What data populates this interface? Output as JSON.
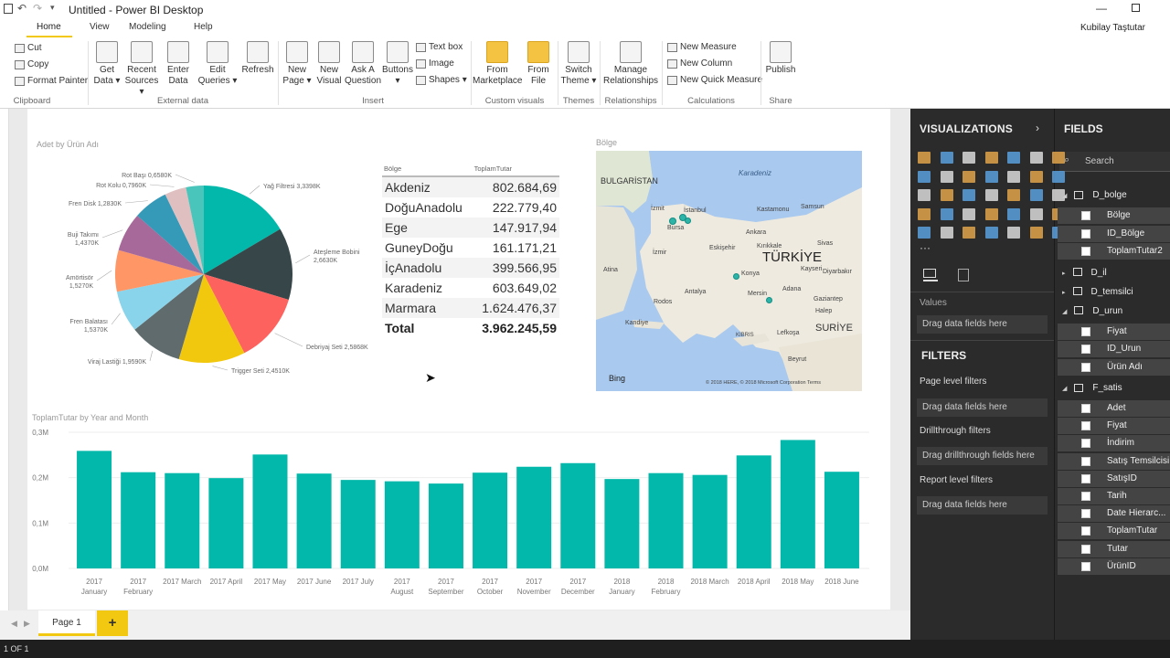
{
  "app": {
    "title": "Untitled - Power BI Desktop",
    "user": "Kubilay Taştutar"
  },
  "tabs": [
    "Home",
    "View",
    "Modeling",
    "Help"
  ],
  "ribbon": {
    "clipboard": {
      "cut": "Cut",
      "copy": "Copy",
      "format_painter": "Format Painter",
      "group": "Clipboard"
    },
    "buttons": [
      {
        "line1": "Get",
        "line2": "Data ▾"
      },
      {
        "line1": "Recent",
        "line2": "Sources ▾"
      },
      {
        "line1": "Enter",
        "line2": "Data"
      },
      {
        "line1": "Edit",
        "line2": "Queries ▾"
      },
      {
        "line1": "Refresh",
        "line2": ""
      },
      {
        "line1": "New",
        "line2": "Page ▾"
      },
      {
        "line1": "New",
        "line2": "Visual"
      },
      {
        "line1": "Ask A",
        "line2": "Question"
      },
      {
        "line1": "Buttons",
        "line2": "▾"
      },
      {
        "line1": "From",
        "line2": "Marketplace"
      },
      {
        "line1": "From",
        "line2": "File"
      },
      {
        "line1": "Switch",
        "line2": "Theme ▾"
      },
      {
        "line1": "Manage",
        "line2": "Relationships"
      },
      {
        "line1": "Publish",
        "line2": ""
      }
    ],
    "insert_small": {
      "text_box": "Text box",
      "image": "Image",
      "shapes": "Shapes ▾"
    },
    "calc_small": {
      "new_measure": "New Measure",
      "new_column": "New Column",
      "new_quick_measure": "New Quick Measure"
    },
    "groups": {
      "external_data": "External data",
      "insert": "Insert",
      "custom_visuals": "Custom visuals",
      "themes": "Themes",
      "relationships": "Relationships",
      "calculations": "Calculations",
      "share": "Share"
    }
  },
  "pie": {
    "title": "Adet by Ürün Adı"
  },
  "table": {
    "title": "Bölge",
    "col1": "Bölge",
    "col2": "ToplamTutar",
    "rows": [
      [
        "Akdeniz",
        "802.684,69"
      ],
      [
        "DoğuAnadolu",
        "222.779,40"
      ],
      [
        "Ege",
        "147.917,94"
      ],
      [
        "GuneyDoğu",
        "161.171,21"
      ],
      [
        "İçAnadolu",
        "399.566,95"
      ],
      [
        "Karadeniz",
        "603.649,02"
      ],
      [
        "Marmara",
        "1.624.476,37"
      ]
    ],
    "total_label": "Total",
    "total_value": "3.962.245,59"
  },
  "map": {
    "title": "Bölge",
    "labels": {
      "bulgaria": "BULGARİSTAN",
      "karadeniz": "Karadeniz",
      "turkiye": "TÜRKİYE",
      "syria": "SURİYE",
      "istanbul": "İstanbul",
      "izmit": "İzmit",
      "bursa": "Bursa",
      "eskisehir": "Eskişehir",
      "ankara": "Ankara",
      "kastamonu": "Kastamonu",
      "samsun": "Samsun",
      "sivas": "Sivas",
      "kayseri": "Kayseri",
      "konya": "Konya",
      "antalya": "Antalya",
      "mersin": "Mersin",
      "adana": "Adana",
      "gaziantep": "Gaziantep",
      "diyarbakir": "Diyarbakır",
      "malatya": "Malatya",
      "izmir": "İzmir",
      "athens": "Atina",
      "rodos": "Rodos",
      "kandiye": "Kandiye",
      "lefkosa": "Lefkoşa",
      "beyrut": "Beyrut",
      "kibris": "KIBRIS",
      "halep": "Halep",
      "kirikkale": "Kırıkkale"
    },
    "bing": "Bing",
    "copyright": "© 2018 HERE, © 2018 Microsoft Corporation  Terms"
  },
  "bar": {
    "title": "ToplamTutar by Year and Month"
  },
  "pages": {
    "page1": "Page 1",
    "add": "+",
    "status": "1 OF 1"
  },
  "viz": {
    "title": "VISUALIZATIONS",
    "values_label": "Values",
    "values_drop": "Drag data fields here"
  },
  "filters": {
    "title": "FILTERS",
    "page_level": "Page level filters",
    "page_drop": "Drag data fields here",
    "drillthrough": "Drillthrough filters",
    "drill_drop": "Drag drillthrough fields here",
    "report_level": "Report level filters",
    "report_drop": "Drag data fields here"
  },
  "fields": {
    "title": "FIELDS",
    "search": "Search",
    "tables": [
      {
        "name": "D_bolge",
        "items": [
          "Bölge",
          "ID_Bölge",
          "ToplamTutar2"
        ]
      },
      {
        "name": "D_il",
        "items": []
      },
      {
        "name": "D_temsilci",
        "items": []
      },
      {
        "name": "D_urun",
        "items": [
          "Fiyat",
          "ID_Urun",
          "Ürün Adı"
        ]
      },
      {
        "name": "F_satis",
        "items": [
          "Adet",
          "Fiyat",
          "İndirim",
          "Satış Temsilcisi",
          "SatışID",
          "Tarih",
          "Date Hierarc...",
          "ToplamTutar",
          "Tutar",
          "ÜrünID"
        ]
      }
    ]
  },
  "chart_data": [
    {
      "type": "pie",
      "title": "Adet by Ürün Adı",
      "categories": [
        "Yağ Filtresi",
        "Ateşleme Bobini",
        "Debriyaj Seti",
        "Trigger Seti",
        "Viraj Lastiği",
        "Fren Balatası",
        "Amörtisör",
        "Buji Takımı",
        "Fren Disk",
        "Rot Kolu",
        "Rot Başı"
      ],
      "values": [
        3.3398,
        2.663,
        2.5868,
        2.451,
        1.959,
        1.537,
        1.527,
        1.437,
        1.283,
        0.796,
        0.658
      ],
      "labels": [
        "Yağ Filtresi 3,3398K",
        "Ateşleme Bobini 2,6630K",
        "Debriyaj Seti 2,5868K",
        "Trigger Seti 2,4510K",
        "Viraj Lastiği 1,9590K",
        "Fren Balatası 1,5370K",
        "Amörtisör 1,5270K",
        "Buji Takımı 1,4370K",
        "Fren Disk 1,2830K",
        "Rot Kolu 0,7960K",
        "Rot Başı 0,6580K"
      ],
      "colors": [
        "#01b8aa",
        "#374649",
        "#fd625e",
        "#f2c80f",
        "#5f6b6d",
        "#8ad4eb",
        "#fe9666",
        "#a66999",
        "#3599b8",
        "#dfbfbf",
        "#4ac5bb",
        "#5f6b6d"
      ]
    },
    {
      "type": "bar",
      "title": "ToplamTutar by Year and Month",
      "color": "#01b8aa",
      "categories": [
        [
          "2017",
          "January"
        ],
        [
          "2017",
          "February"
        ],
        [
          "2017 March",
          ""
        ],
        [
          "2017 April",
          ""
        ],
        [
          "2017 May",
          ""
        ],
        [
          "2017 June",
          ""
        ],
        [
          "2017 July",
          ""
        ],
        [
          "2017",
          "August"
        ],
        [
          "2017",
          "September"
        ],
        [
          "2017",
          "October"
        ],
        [
          "2017",
          "November"
        ],
        [
          "2017",
          "December"
        ],
        [
          "2018",
          "January"
        ],
        [
          "2018",
          "February"
        ],
        [
          "2018 March",
          ""
        ],
        [
          "2018 April",
          ""
        ],
        [
          "2018 May",
          ""
        ],
        [
          "2018 June",
          ""
        ]
      ],
      "values": [
        0.259,
        0.212,
        0.21,
        0.199,
        0.251,
        0.209,
        0.195,
        0.192,
        0.187,
        0.211,
        0.224,
        0.232,
        0.197,
        0.21,
        0.206,
        0.249,
        0.283,
        0.213
      ],
      "ylim": [
        0,
        0.3
      ],
      "yticks": [
        "0,0M",
        "0,1M",
        "0,2M",
        "0,3M"
      ],
      "unit": "M"
    }
  ]
}
